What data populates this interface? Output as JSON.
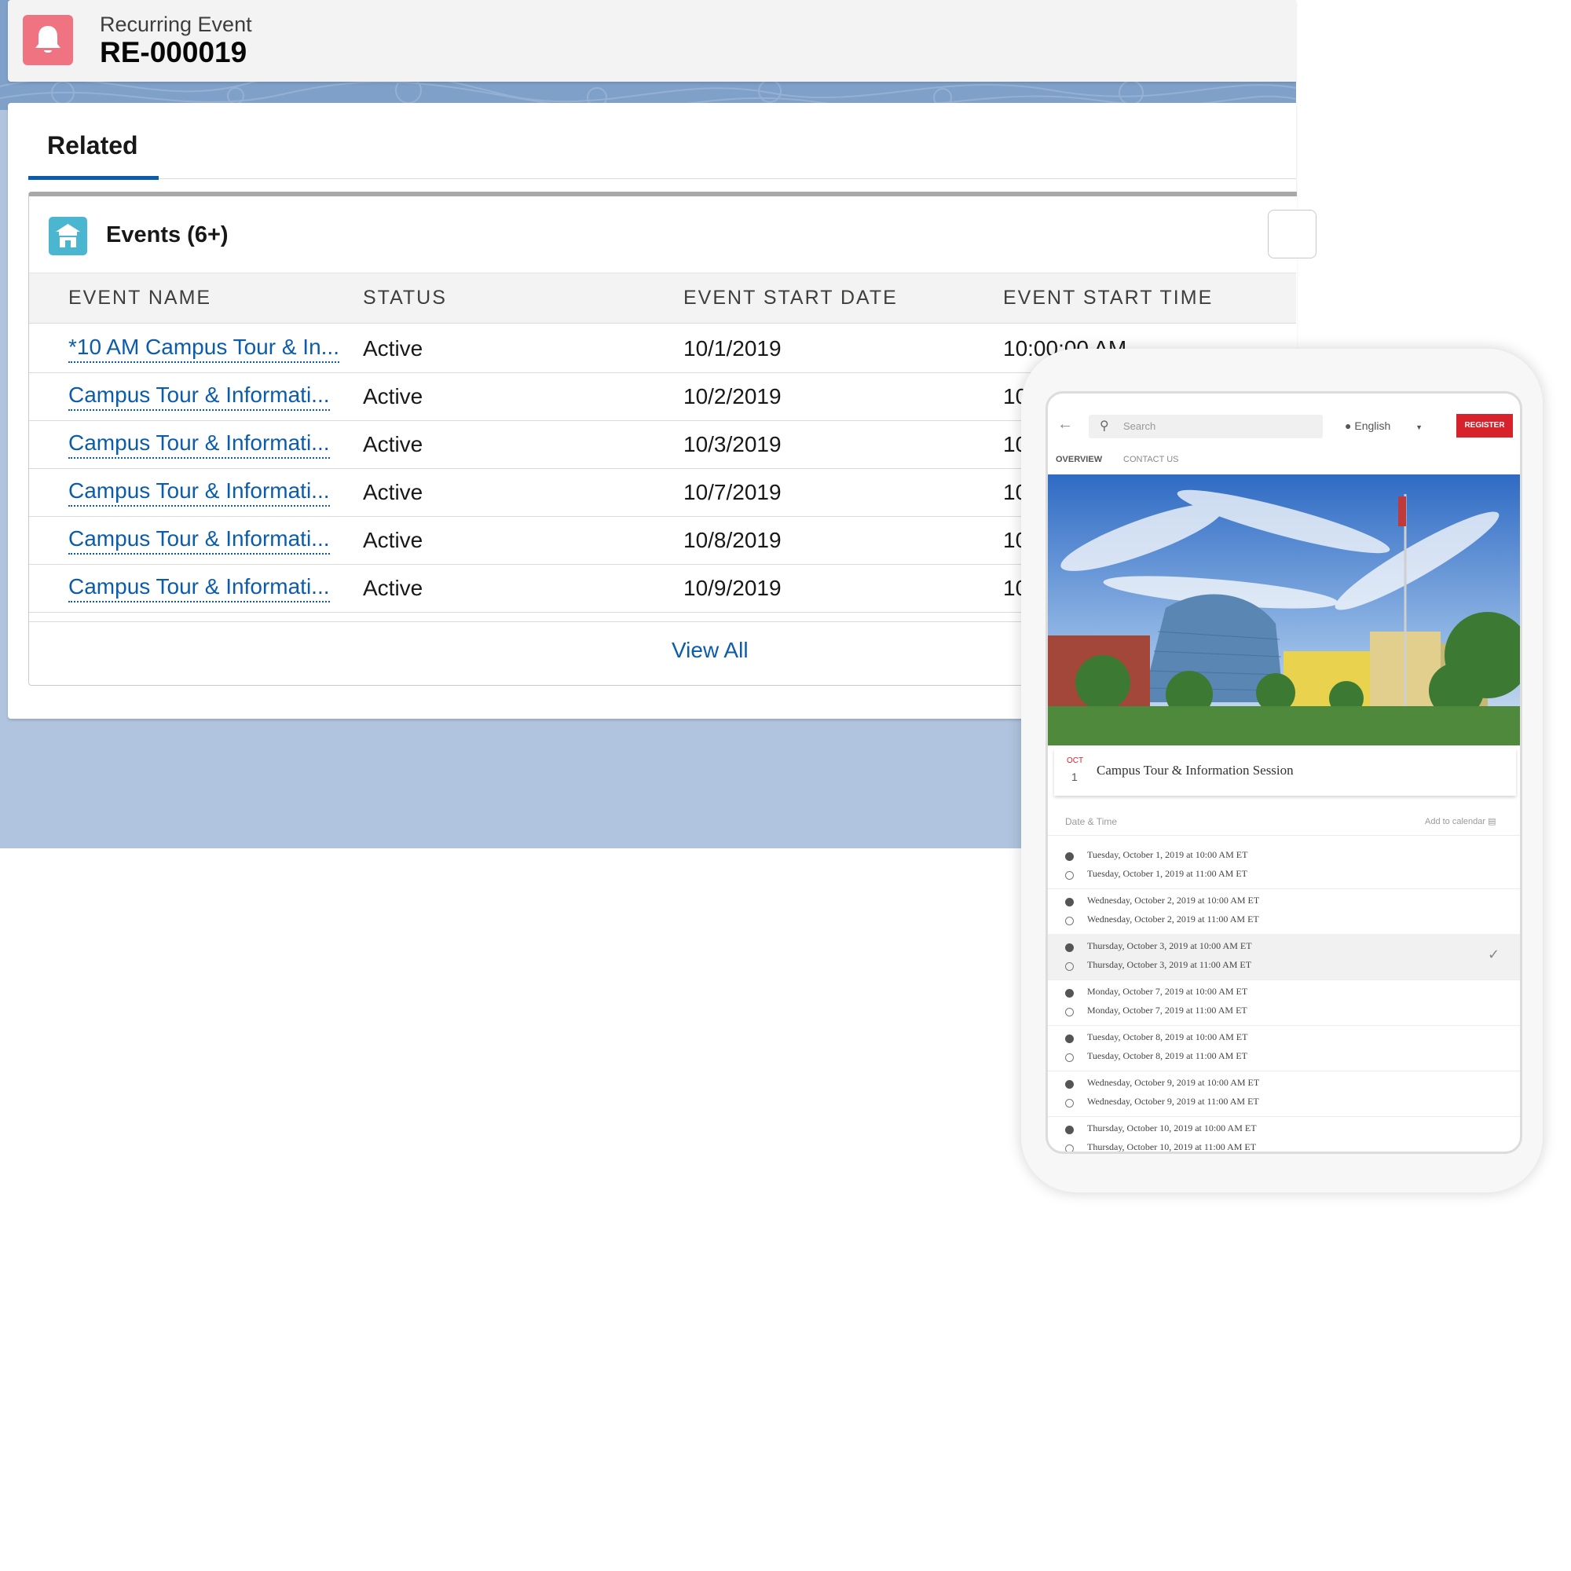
{
  "record": {
    "type_label": "Recurring Event",
    "name": "RE-000019",
    "icon": "bell-icon",
    "icon_color": "#f07381"
  },
  "tabs": [
    {
      "label": "Related",
      "active": true
    }
  ],
  "related_list": {
    "icon": "event-icon",
    "icon_color": "#4bb6d0",
    "title": "Events (6+)",
    "columns": [
      "EVENT NAME",
      "STATUS",
      "EVENT START DATE",
      "EVENT START TIME"
    ],
    "rows": [
      {
        "name": "*10 AM Campus Tour & In...",
        "status": "Active",
        "start_date": "10/1/2019",
        "start_time": "10:00:00 AM"
      },
      {
        "name": "Campus Tour & Informati...",
        "status": "Active",
        "start_date": "10/2/2019",
        "start_time": "10"
      },
      {
        "name": "Campus Tour & Informati...",
        "status": "Active",
        "start_date": "10/3/2019",
        "start_time": "10"
      },
      {
        "name": "Campus Tour & Informati...",
        "status": "Active",
        "start_date": "10/7/2019",
        "start_time": "10"
      },
      {
        "name": "Campus Tour & Informati...",
        "status": "Active",
        "start_date": "10/8/2019",
        "start_time": "10"
      },
      {
        "name": "Campus Tour & Informati...",
        "status": "Active",
        "start_date": "10/9/2019",
        "start_time": "10"
      }
    ],
    "view_all_label": "View All",
    "link_color": "#0b5cab"
  },
  "phone": {
    "search_placeholder": "Search",
    "language": "English",
    "register_label": "REGISTER",
    "register_color": "#d7222c",
    "tabs": [
      "OVERVIEW",
      "CONTACT US"
    ],
    "event": {
      "month": "OCT",
      "day": "1",
      "title": "Campus Tour & Information Session"
    },
    "date_time_label": "Date & Time",
    "add_to_calendar_label": "Add to calendar",
    "sessions": [
      {
        "line1": "Tuesday, October 1, 2019 at 10:00 AM ET",
        "line2": "Tuesday, October 1, 2019 at 11:00 AM ET",
        "selected": false
      },
      {
        "line1": "Wednesday, October 2, 2019 at 10:00 AM ET",
        "line2": "Wednesday, October 2, 2019 at 11:00 AM ET",
        "selected": false
      },
      {
        "line1": "Thursday, October 3, 2019 at 10:00 AM ET",
        "line2": "Thursday, October 3, 2019 at 11:00 AM ET",
        "selected": true
      },
      {
        "line1": "Monday, October 7, 2019 at 10:00 AM ET",
        "line2": "Monday, October 7, 2019 at 11:00 AM ET",
        "selected": false
      },
      {
        "line1": "Tuesday, October 8, 2019 at 10:00 AM ET",
        "line2": "Tuesday, October 8, 2019 at 11:00 AM ET",
        "selected": false
      },
      {
        "line1": "Wednesday, October 9, 2019 at 10:00 AM ET",
        "line2": "Wednesday, October 9, 2019 at 11:00 AM ET",
        "selected": false
      },
      {
        "line1": "Thursday, October 10, 2019 at 10:00 AM ET",
        "line2": "Thursday, October 10, 2019 at 11:00 AM ET",
        "selected": false
      }
    ]
  }
}
